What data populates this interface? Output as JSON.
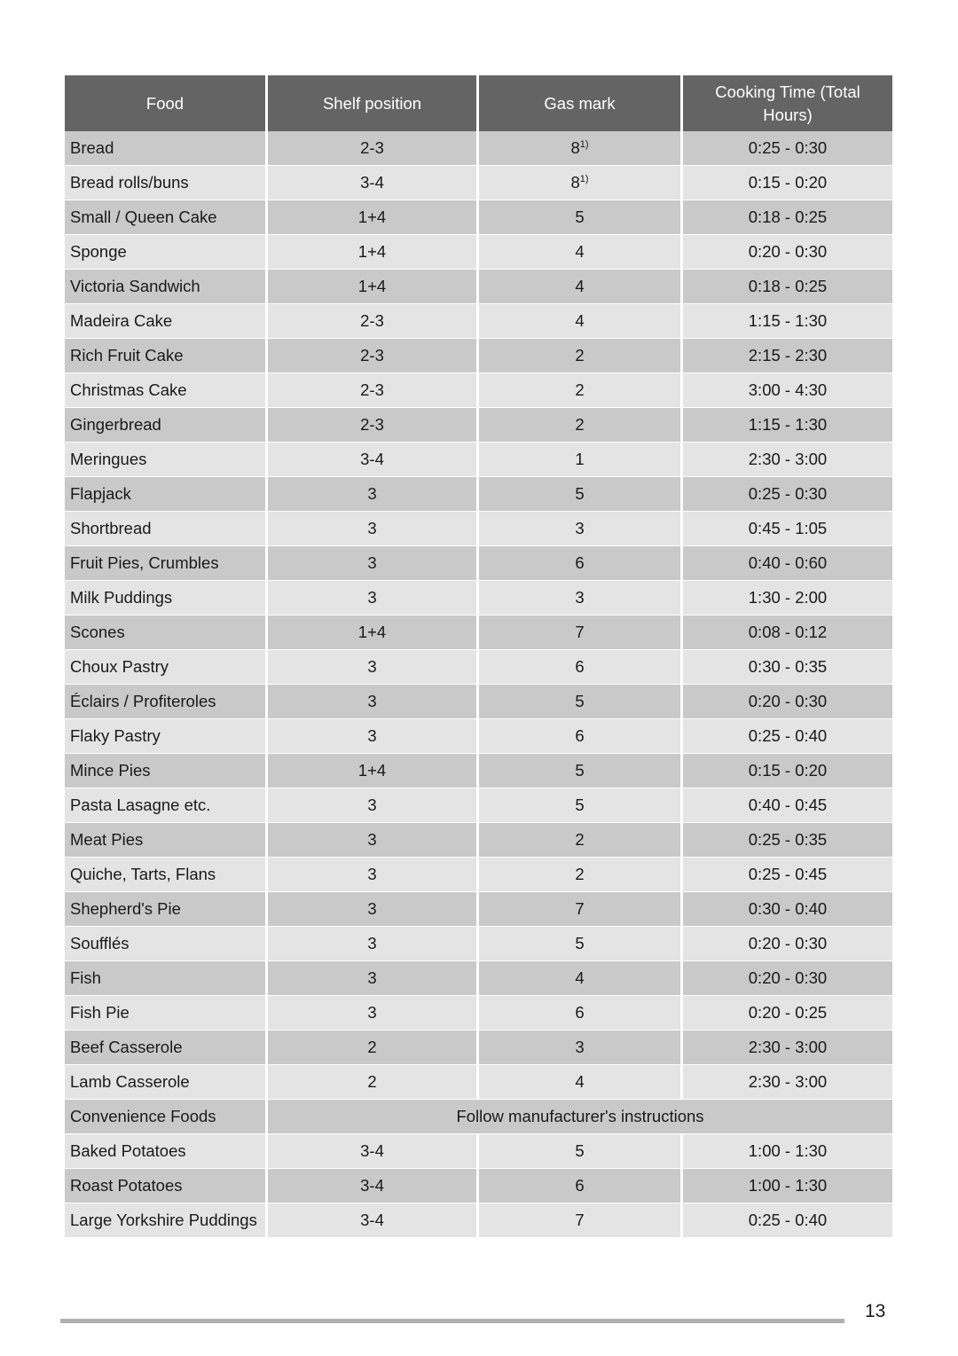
{
  "document": {
    "page_number": "13"
  },
  "table": {
    "headers": [
      "Food",
      "Shelf position",
      "Gas mark",
      "Cooking Time (Total Hours)"
    ],
    "merged_note": "Follow manufacturer's instructions",
    "gas_mark_footnote_marker": "1)",
    "rows": [
      {
        "food": "Bread",
        "shelf": "2-3",
        "gas": "8",
        "gas_sup": "1)",
        "time": "0:25 - 0:30"
      },
      {
        "food": "Bread rolls/buns",
        "shelf": "3-4",
        "gas": "8",
        "gas_sup": "1)",
        "time": "0:15 - 0:20"
      },
      {
        "food": "Small / Queen Cake",
        "shelf": "1+4",
        "gas": "5",
        "gas_sup": "",
        "time": "0:18 - 0:25"
      },
      {
        "food": "Sponge",
        "shelf": "1+4",
        "gas": "4",
        "gas_sup": "",
        "time": "0:20 - 0:30"
      },
      {
        "food": "Victoria Sandwich",
        "shelf": "1+4",
        "gas": "4",
        "gas_sup": "",
        "time": "0:18 - 0:25"
      },
      {
        "food": "Madeira Cake",
        "shelf": "2-3",
        "gas": "4",
        "gas_sup": "",
        "time": "1:15 - 1:30"
      },
      {
        "food": "Rich Fruit Cake",
        "shelf": "2-3",
        "gas": "2",
        "gas_sup": "",
        "time": "2:15 - 2:30"
      },
      {
        "food": "Christmas Cake",
        "shelf": "2-3",
        "gas": "2",
        "gas_sup": "",
        "time": "3:00 - 4:30"
      },
      {
        "food": "Gingerbread",
        "shelf": "2-3",
        "gas": "2",
        "gas_sup": "",
        "time": "1:15 - 1:30"
      },
      {
        "food": "Meringues",
        "shelf": "3-4",
        "gas": "1",
        "gas_sup": "",
        "time": "2:30 - 3:00"
      },
      {
        "food": "Flapjack",
        "shelf": "3",
        "gas": "5",
        "gas_sup": "",
        "time": "0:25 - 0:30"
      },
      {
        "food": "Shortbread",
        "shelf": "3",
        "gas": "3",
        "gas_sup": "",
        "time": "0:45 - 1:05"
      },
      {
        "food": "Fruit Pies, Crumbles",
        "shelf": "3",
        "gas": "6",
        "gas_sup": "",
        "time": "0:40 - 0:60"
      },
      {
        "food": "Milk Puddings",
        "shelf": "3",
        "gas": "3",
        "gas_sup": "",
        "time": "1:30 - 2:00"
      },
      {
        "food": "Scones",
        "shelf": "1+4",
        "gas": "7",
        "gas_sup": "",
        "time": "0:08 - 0:12"
      },
      {
        "food": "Choux Pastry",
        "shelf": "3",
        "gas": "6",
        "gas_sup": "",
        "time": "0:30 - 0:35"
      },
      {
        "food": "Éclairs / Profiteroles",
        "shelf": "3",
        "gas": "5",
        "gas_sup": "",
        "time": "0:20 - 0:30"
      },
      {
        "food": "Flaky Pastry",
        "shelf": "3",
        "gas": "6",
        "gas_sup": "",
        "time": "0:25 - 0:40"
      },
      {
        "food": "Mince Pies",
        "shelf": "1+4",
        "gas": "5",
        "gas_sup": "",
        "time": "0:15 - 0:20"
      },
      {
        "food": "Pasta Lasagne etc.",
        "shelf": "3",
        "gas": "5",
        "gas_sup": "",
        "time": "0:40 - 0:45"
      },
      {
        "food": "Meat Pies",
        "shelf": "3",
        "gas": "2",
        "gas_sup": "",
        "time": "0:25 - 0:35"
      },
      {
        "food": "Quiche, Tarts, Flans",
        "shelf": "3",
        "gas": "2",
        "gas_sup": "",
        "time": "0:25 - 0:45"
      },
      {
        "food": "Shepherd's Pie",
        "shelf": "3",
        "gas": "7",
        "gas_sup": "",
        "time": "0:30 - 0:40"
      },
      {
        "food": "Soufflés",
        "shelf": "3",
        "gas": "5",
        "gas_sup": "",
        "time": "0:20 - 0:30"
      },
      {
        "food": "Fish",
        "shelf": "3",
        "gas": "4",
        "gas_sup": "",
        "time": "0:20 - 0:30"
      },
      {
        "food": "Fish Pie",
        "shelf": "3",
        "gas": "6",
        "gas_sup": "",
        "time": "0:20 - 0:25"
      },
      {
        "food": "Beef Casserole",
        "shelf": "2",
        "gas": "3",
        "gas_sup": "",
        "time": "2:30 - 3:00"
      },
      {
        "food": "Lamb Casserole",
        "shelf": "2",
        "gas": "4",
        "gas_sup": "",
        "time": "2:30 - 3:00"
      },
      {
        "food": "Convenience Foods",
        "merged": "Follow manufacturer's instructions"
      },
      {
        "food": "Baked Potatoes",
        "shelf": "3-4",
        "gas": "5",
        "gas_sup": "",
        "time": "1:00 - 1:30"
      },
      {
        "food": "Roast Potatoes",
        "shelf": "3-4",
        "gas": "6",
        "gas_sup": "",
        "time": "1:00 - 1:30"
      },
      {
        "food": "Large Yorkshire Puddings",
        "shelf": "3-4",
        "gas": "7",
        "gas_sup": "",
        "time": "0:25 - 0:40"
      }
    ]
  },
  "colors": {
    "header_bg": "#646464",
    "header_text": "#ffffff",
    "row_odd_bg": "#c9c9c9",
    "row_even_bg": "#e4e4e4",
    "body_text": "#1a1a1a",
    "rule": "#b0b0b0",
    "page_bg": "#ffffff"
  }
}
